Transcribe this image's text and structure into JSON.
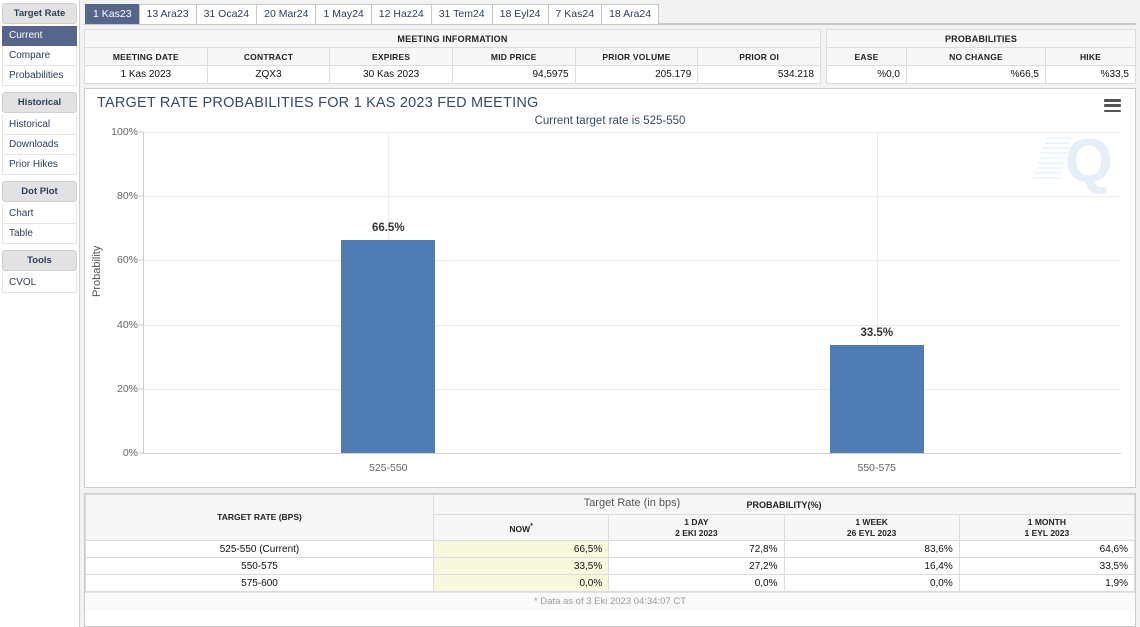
{
  "sidebar": {
    "groups": [
      {
        "title": "Target Rate",
        "items": [
          {
            "label": "Current",
            "active": true
          },
          {
            "label": "Compare",
            "active": false
          },
          {
            "label": "Probabilities",
            "active": false
          }
        ]
      },
      {
        "title": "Historical",
        "items": [
          {
            "label": "Historical",
            "active": false
          },
          {
            "label": "Downloads",
            "active": false
          },
          {
            "label": "Prior Hikes",
            "active": false
          }
        ]
      },
      {
        "title": "Dot Plot",
        "items": [
          {
            "label": "Chart",
            "active": false
          },
          {
            "label": "Table",
            "active": false
          }
        ]
      },
      {
        "title": "Tools",
        "items": [
          {
            "label": "CVOL",
            "active": false
          }
        ]
      }
    ]
  },
  "tabs": [
    {
      "label": "1 Kas23",
      "active": true
    },
    {
      "label": "13 Ara23",
      "active": false
    },
    {
      "label": "31 Oca24",
      "active": false
    },
    {
      "label": "20 Mar24",
      "active": false
    },
    {
      "label": "1 May24",
      "active": false
    },
    {
      "label": "12 Haz24",
      "active": false
    },
    {
      "label": "31 Tem24",
      "active": false
    },
    {
      "label": "18 Eyl24",
      "active": false
    },
    {
      "label": "7 Kas24",
      "active": false
    },
    {
      "label": "18 Ara24",
      "active": false
    }
  ],
  "meeting_info": {
    "group_title": "MEETING INFORMATION",
    "headers": [
      "MEETING DATE",
      "CONTRACT",
      "EXPIRES",
      "MID PRICE",
      "PRIOR VOLUME",
      "PRIOR OI"
    ],
    "values": [
      "1 Kas 2023",
      "ZQX3",
      "30 Kas 2023",
      "94,5975",
      "205.179",
      "534.218"
    ]
  },
  "probabilities_summary": {
    "group_title": "PROBABILITIES",
    "headers": [
      "EASE",
      "NO CHANGE",
      "HIKE"
    ],
    "values": [
      "%0,0",
      "%66,5",
      "%33,5"
    ]
  },
  "chart": {
    "title": "TARGET RATE PROBABILITIES FOR 1 KAS 2023 FED MEETING",
    "subtitle": "Current target rate is 525-550",
    "menu_icon": "hamburger-icon",
    "watermark": "Q",
    "bar_color": "#4f7cb5"
  },
  "chart_data": {
    "type": "bar",
    "title": "TARGET RATE PROBABILITIES FOR 1 KAS 2023 FED MEETING",
    "subtitle": "Current target rate is 525-550",
    "categories": [
      "525-550",
      "550-575"
    ],
    "values": [
      66.5,
      33.5
    ],
    "data_labels": [
      "66.5%",
      "33.5%"
    ],
    "xlabel": "Target Rate (in bps)",
    "ylabel": "Probability",
    "ylim": [
      0,
      100
    ],
    "yticks": [
      0,
      20,
      40,
      60,
      80,
      100
    ],
    "ytick_labels": [
      "0%",
      "20%",
      "40%",
      "60%",
      "80%",
      "100%"
    ],
    "grid": true,
    "legend": false
  },
  "detail_table": {
    "rate_header": "TARGET RATE (BPS)",
    "group_header": "PROBABILITY(%)",
    "columns": [
      {
        "title": "NOW",
        "sub": "",
        "superscript": "*"
      },
      {
        "title": "1 DAY",
        "sub": "2 EKI 2023",
        "superscript": ""
      },
      {
        "title": "1 WEEK",
        "sub": "26 EYL 2023",
        "superscript": ""
      },
      {
        "title": "1 MONTH",
        "sub": "1 EYL 2023",
        "superscript": ""
      }
    ],
    "rows": [
      {
        "rate": "525-550 (Current)",
        "now": "66,5%",
        "day": "72,8%",
        "week": "83,6%",
        "month": "64,6%"
      },
      {
        "rate": "550-575",
        "now": "33,5%",
        "day": "27,2%",
        "week": "16,4%",
        "month": "33,5%"
      },
      {
        "rate": "575-600",
        "now": "0,0%",
        "day": "0,0%",
        "week": "0,0%",
        "month": "1,9%"
      }
    ],
    "footnote": "* Data as of 3 Eki 2023 04:34:07 CT"
  }
}
